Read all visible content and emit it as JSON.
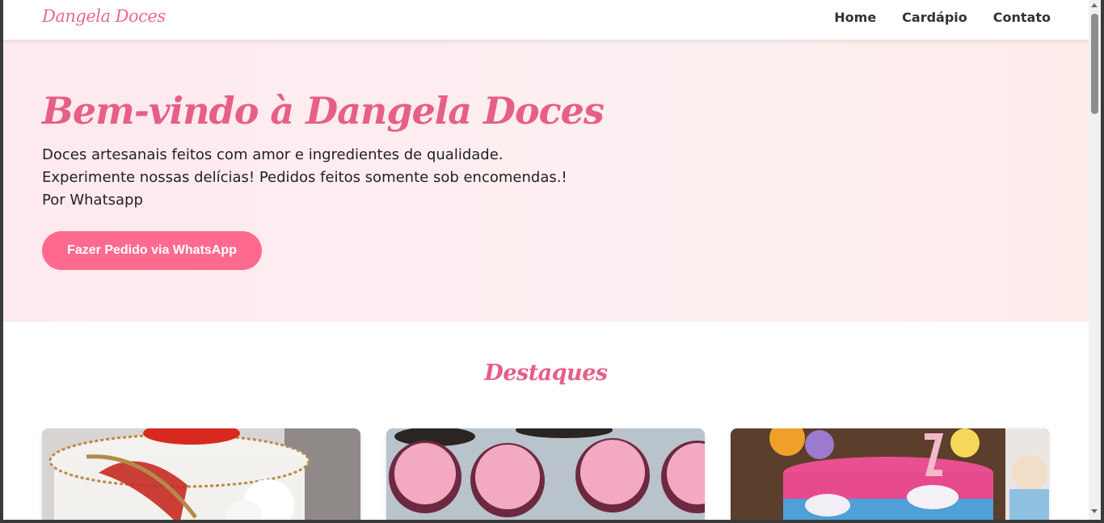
{
  "navbar": {
    "brand": "Dangela Doces",
    "links": [
      "Home",
      "Cardápio",
      "Contato"
    ]
  },
  "hero": {
    "title": "Bem-vindo à Dangela Doces",
    "lines": [
      "Doces artesanais feitos com amor e ingredientes de qualidade.",
      "Experimente nossas delícias! Pedidos feitos somente sob encomendas.!",
      "Por Whatsapp"
    ],
    "cta_label": "Fazer Pedido via WhatsApp"
  },
  "highlights": {
    "title": "Destaques"
  },
  "colors": {
    "accent": "#fe6a8e",
    "brand_text": "#e55f86",
    "hero_bg": "#fde9ef"
  }
}
